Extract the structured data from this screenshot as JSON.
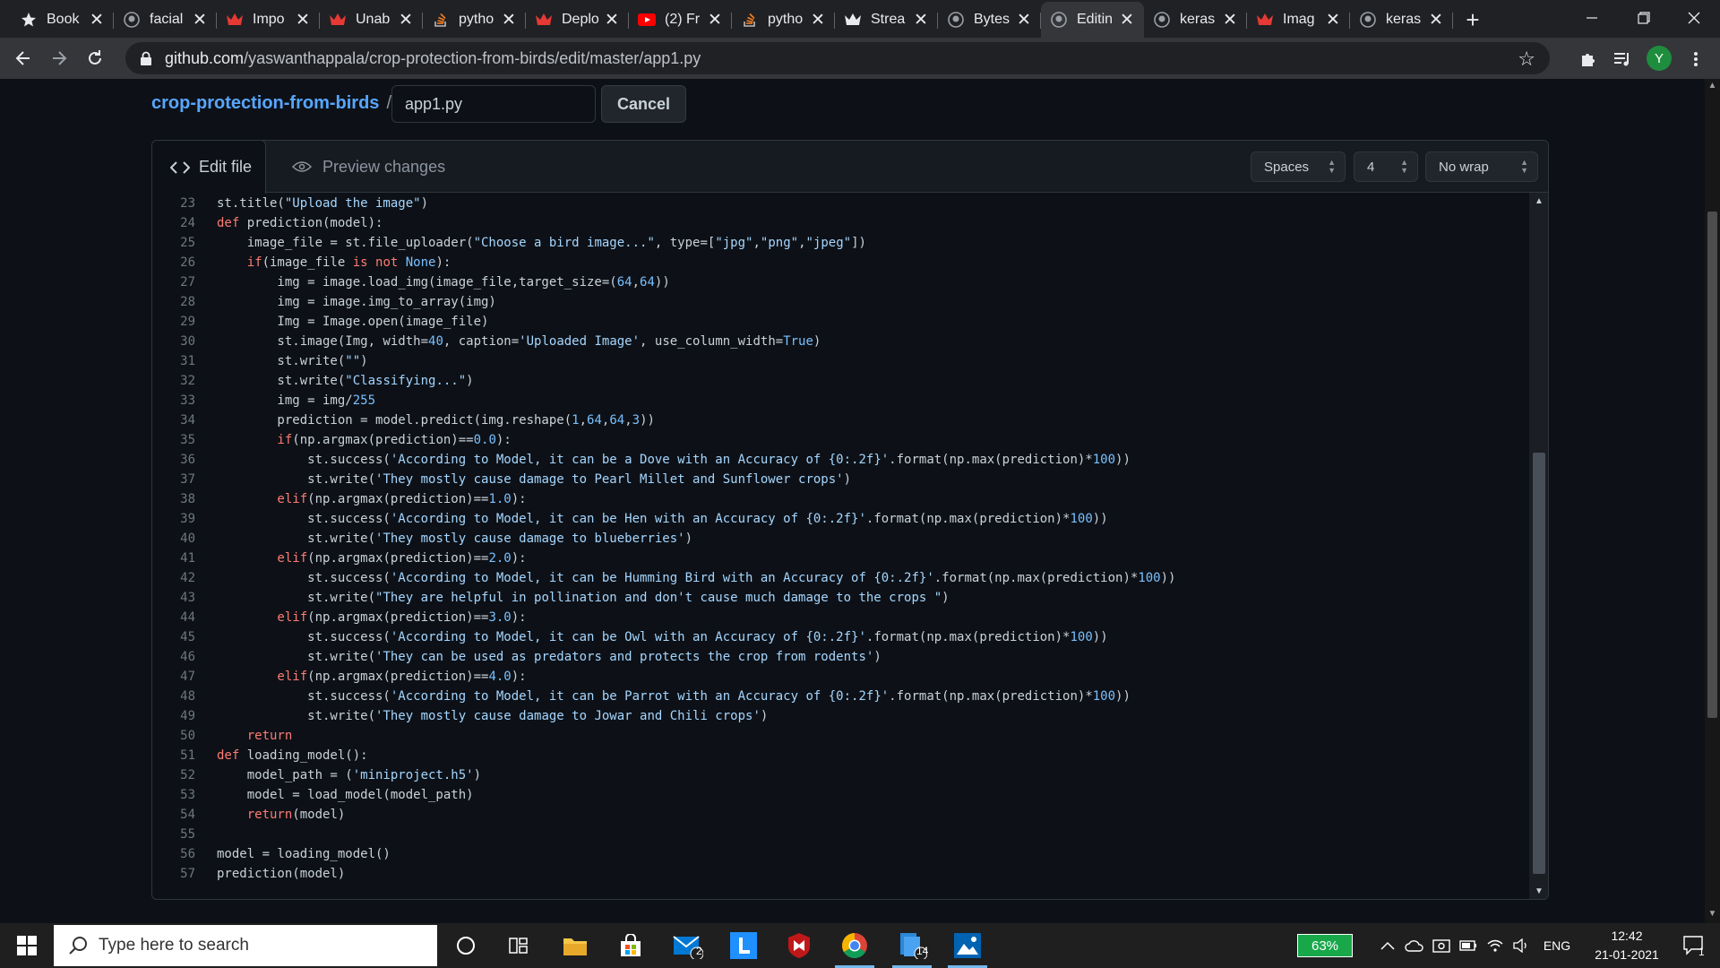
{
  "browser": {
    "tabs": [
      {
        "label": "Book",
        "icon": "star-icon"
      },
      {
        "label": "facial",
        "icon": "github-icon"
      },
      {
        "label": "Impo",
        "icon": "crown-icon"
      },
      {
        "label": "Unab",
        "icon": "crown-icon"
      },
      {
        "label": "pytho",
        "icon": "stackoverflow-icon"
      },
      {
        "label": "Deplo",
        "icon": "crown-icon"
      },
      {
        "label": "(2) Fr",
        "icon": "youtube-icon"
      },
      {
        "label": "pytho",
        "icon": "stackoverflow-icon"
      },
      {
        "label": "Strea",
        "icon": "streamlit-icon"
      },
      {
        "label": "Bytes",
        "icon": "github-icon"
      },
      {
        "label": "Editin",
        "icon": "github-icon",
        "active": true
      },
      {
        "label": "keras",
        "icon": "github-icon"
      },
      {
        "label": "Imag",
        "icon": "crown-icon"
      },
      {
        "label": "keras",
        "icon": "github-icon"
      }
    ],
    "close_glyph": "✕",
    "new_tab": "+",
    "url_host": "github.com",
    "url_path": "/yaswanthappala/crop-protection-from-birds/edit/master/app1.py",
    "profile_initial": "Y"
  },
  "editor": {
    "repo_name": "crop-protection-from-birds",
    "separator": "/",
    "filename": "app1.py",
    "cancel_label": "Cancel",
    "tab_edit": "Edit file",
    "tab_preview": "Preview changes",
    "indent_mode": "Spaces",
    "indent_size": "4",
    "wrap_mode": "No wrap",
    "lines": [
      {
        "n": "23",
        "tokens": [
          [
            "d",
            "st.title("
          ],
          [
            "s",
            "\"Upload the image\""
          ],
          [
            "d",
            ")"
          ]
        ]
      },
      {
        "n": "24",
        "tokens": [
          [
            "k",
            "def "
          ],
          [
            "d",
            "prediction(model):"
          ]
        ]
      },
      {
        "n": "25",
        "tokens": [
          [
            "d",
            "    image_file = st.file_uploader("
          ],
          [
            "s",
            "\"Choose a bird image...\""
          ],
          [
            "d",
            ", type=["
          ],
          [
            "s",
            "\"jpg\""
          ],
          [
            "d",
            ","
          ],
          [
            "s",
            "\"png\""
          ],
          [
            "d",
            ","
          ],
          [
            "s",
            "\"jpeg\""
          ],
          [
            "d",
            "])"
          ]
        ]
      },
      {
        "n": "26",
        "tokens": [
          [
            "k",
            "    if"
          ],
          [
            "d",
            "(image_file "
          ],
          [
            "k",
            "is not "
          ],
          [
            "n",
            "None"
          ],
          [
            "d",
            "):"
          ]
        ]
      },
      {
        "n": "27",
        "tokens": [
          [
            "d",
            "        img = image.load_img(image_file,target_size=("
          ],
          [
            "n",
            "64"
          ],
          [
            "d",
            ","
          ],
          [
            "n",
            "64"
          ],
          [
            "d",
            "))"
          ]
        ]
      },
      {
        "n": "28",
        "tokens": [
          [
            "d",
            "        img = image.img_to_array(img)"
          ]
        ]
      },
      {
        "n": "29",
        "tokens": [
          [
            "d",
            "        Img = Image.open(image_file)"
          ]
        ]
      },
      {
        "n": "30",
        "tokens": [
          [
            "d",
            "        st.image(Img, width="
          ],
          [
            "n",
            "40"
          ],
          [
            "d",
            ", caption="
          ],
          [
            "s",
            "'Uploaded Image'"
          ],
          [
            "d",
            ", use_column_width="
          ],
          [
            "n",
            "True"
          ],
          [
            "d",
            ")"
          ]
        ]
      },
      {
        "n": "31",
        "tokens": [
          [
            "d",
            "        st.write("
          ],
          [
            "s",
            "\"\""
          ],
          [
            "d",
            ")"
          ]
        ]
      },
      {
        "n": "32",
        "tokens": [
          [
            "d",
            "        st.write("
          ],
          [
            "s",
            "\"Classifying...\""
          ],
          [
            "d",
            ")"
          ]
        ]
      },
      {
        "n": "33",
        "tokens": [
          [
            "d",
            "        img = img/"
          ],
          [
            "n",
            "255"
          ]
        ]
      },
      {
        "n": "34",
        "tokens": [
          [
            "d",
            "        prediction = model.predict(img.reshape("
          ],
          [
            "n",
            "1"
          ],
          [
            "d",
            ","
          ],
          [
            "n",
            "64"
          ],
          [
            "d",
            ","
          ],
          [
            "n",
            "64"
          ],
          [
            "d",
            ","
          ],
          [
            "n",
            "3"
          ],
          [
            "d",
            "))"
          ]
        ]
      },
      {
        "n": "35",
        "tokens": [
          [
            "k",
            "        if"
          ],
          [
            "d",
            "(np.argmax(prediction)=="
          ],
          [
            "n",
            "0.0"
          ],
          [
            "d",
            "):"
          ]
        ]
      },
      {
        "n": "36",
        "tokens": [
          [
            "d",
            "            st.success("
          ],
          [
            "s",
            "'According to Model, it can be a Dove with an Accuracy of {0:.2f}'"
          ],
          [
            "d",
            ".format(np.max(prediction)*"
          ],
          [
            "n",
            "100"
          ],
          [
            "d",
            "))"
          ]
        ]
      },
      {
        "n": "37",
        "tokens": [
          [
            "d",
            "            st.write("
          ],
          [
            "s",
            "'They mostly cause damage to Pearl Millet and Sunflower crops'"
          ],
          [
            "d",
            ")"
          ]
        ]
      },
      {
        "n": "38",
        "tokens": [
          [
            "k",
            "        elif"
          ],
          [
            "d",
            "(np.argmax(prediction)=="
          ],
          [
            "n",
            "1.0"
          ],
          [
            "d",
            "):"
          ]
        ]
      },
      {
        "n": "39",
        "tokens": [
          [
            "d",
            "            st.success("
          ],
          [
            "s",
            "'According to Model, it can be Hen with an Accuracy of {0:.2f}'"
          ],
          [
            "d",
            ".format(np.max(prediction)*"
          ],
          [
            "n",
            "100"
          ],
          [
            "d",
            "))"
          ]
        ]
      },
      {
        "n": "40",
        "tokens": [
          [
            "d",
            "            st.write("
          ],
          [
            "s",
            "'They mostly cause damage to blueberries'"
          ],
          [
            "d",
            ")"
          ]
        ]
      },
      {
        "n": "41",
        "tokens": [
          [
            "k",
            "        elif"
          ],
          [
            "d",
            "(np.argmax(prediction)=="
          ],
          [
            "n",
            "2.0"
          ],
          [
            "d",
            "):"
          ]
        ]
      },
      {
        "n": "42",
        "tokens": [
          [
            "d",
            "            st.success("
          ],
          [
            "s",
            "'According to Model, it can be Humming Bird with an Accuracy of {0:.2f}'"
          ],
          [
            "d",
            ".format(np.max(prediction)*"
          ],
          [
            "n",
            "100"
          ],
          [
            "d",
            "))"
          ]
        ]
      },
      {
        "n": "43",
        "tokens": [
          [
            "d",
            "            st.write("
          ],
          [
            "s",
            "\"They are helpful in pollination and don't cause much damage to the crops \""
          ],
          [
            "d",
            ")"
          ]
        ]
      },
      {
        "n": "44",
        "tokens": [
          [
            "k",
            "        elif"
          ],
          [
            "d",
            "(np.argmax(prediction)=="
          ],
          [
            "n",
            "3.0"
          ],
          [
            "d",
            "):"
          ]
        ]
      },
      {
        "n": "45",
        "tokens": [
          [
            "d",
            "            st.success("
          ],
          [
            "s",
            "'According to Model, it can be Owl with an Accuracy of {0:.2f}'"
          ],
          [
            "d",
            ".format(np.max(prediction)*"
          ],
          [
            "n",
            "100"
          ],
          [
            "d",
            "))"
          ]
        ]
      },
      {
        "n": "46",
        "tokens": [
          [
            "d",
            "            st.write("
          ],
          [
            "s",
            "'They can be used as predators and protects the crop from rodents'"
          ],
          [
            "d",
            ")"
          ]
        ]
      },
      {
        "n": "47",
        "tokens": [
          [
            "k",
            "        elif"
          ],
          [
            "d",
            "(np.argmax(prediction)=="
          ],
          [
            "n",
            "4.0"
          ],
          [
            "d",
            "):"
          ]
        ]
      },
      {
        "n": "48",
        "tokens": [
          [
            "d",
            "            st.success("
          ],
          [
            "s",
            "'According to Model, it can be Parrot with an Accuracy of {0:.2f}'"
          ],
          [
            "d",
            ".format(np.max(prediction)*"
          ],
          [
            "n",
            "100"
          ],
          [
            "d",
            "))"
          ]
        ]
      },
      {
        "n": "49",
        "tokens": [
          [
            "d",
            "            st.write("
          ],
          [
            "s",
            "'They mostly cause damage to Jowar and Chili crops'"
          ],
          [
            "d",
            ")"
          ]
        ]
      },
      {
        "n": "50",
        "tokens": [
          [
            "k",
            "    return"
          ]
        ]
      },
      {
        "n": "51",
        "tokens": [
          [
            "k",
            "def "
          ],
          [
            "d",
            "loading_model():"
          ]
        ]
      },
      {
        "n": "52",
        "tokens": [
          [
            "d",
            "    model_path = ("
          ],
          [
            "s",
            "'miniproject.h5'"
          ],
          [
            "d",
            ")"
          ]
        ]
      },
      {
        "n": "53",
        "tokens": [
          [
            "d",
            "    model = load_model(model_path)"
          ]
        ]
      },
      {
        "n": "54",
        "tokens": [
          [
            "k",
            "    return"
          ],
          [
            "d",
            "(model)"
          ]
        ]
      },
      {
        "n": "55",
        "tokens": []
      },
      {
        "n": "56",
        "tokens": [
          [
            "d",
            "model = loading_model()"
          ]
        ]
      },
      {
        "n": "57",
        "tokens": [
          [
            "d",
            "prediction(model)"
          ]
        ]
      }
    ]
  },
  "taskbar": {
    "search_placeholder": "Type here to search",
    "mail_badge": "2",
    "files_badge": "14",
    "battery": "63%",
    "language": "ENG",
    "time": "12:42",
    "date": "21-01-2021",
    "notification_count": "1"
  },
  "colors": {
    "link": "#58a6ff",
    "keyword": "#ff7b72",
    "string": "#a5d6ff",
    "number": "#79c0ff",
    "battery": "#18a84a"
  }
}
